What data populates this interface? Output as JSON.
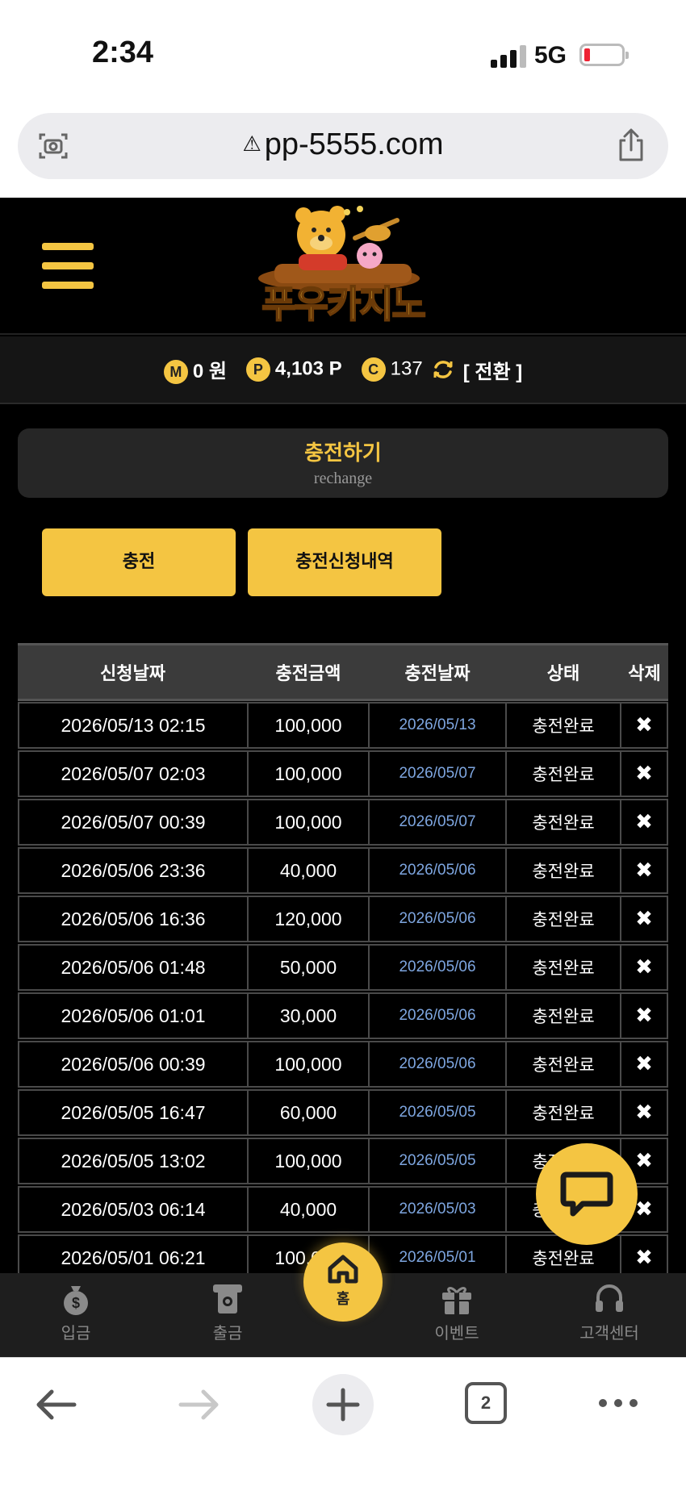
{
  "status_bar": {
    "time": "2:34",
    "network": "5G"
  },
  "browser": {
    "url": "pp-5555.com",
    "warning_glyph": "⚠",
    "tabs_count": "2"
  },
  "site": {
    "logo_text": "푸우카지노",
    "balance": {
      "m_badge": "M",
      "m_value": "0 원",
      "p_badge": "P",
      "p_value": "4,103 P",
      "c_badge": "C",
      "c_value": "137",
      "convert_label": "[ 전환 ]"
    },
    "section": {
      "title": "충전하기",
      "subtitle": "rechange"
    },
    "buttons": {
      "charge": "충전",
      "history": "충전신청내역"
    },
    "table": {
      "headers": [
        "신청날짜",
        "충전금액",
        "충전날짜",
        "상태",
        "삭제"
      ],
      "rows": [
        [
          "2026/05/13 02:15",
          "100,000",
          "2026/05/13",
          "충전완료"
        ],
        [
          "2026/05/07 02:03",
          "100,000",
          "2026/05/07",
          "충전완료"
        ],
        [
          "2026/05/07 00:39",
          "100,000",
          "2026/05/07",
          "충전완료"
        ],
        [
          "2026/05/06 23:36",
          "40,000",
          "2026/05/06",
          "충전완료"
        ],
        [
          "2026/05/06 16:36",
          "120,000",
          "2026/05/06",
          "충전완료"
        ],
        [
          "2026/05/06 01:48",
          "50,000",
          "2026/05/06",
          "충전완료"
        ],
        [
          "2026/05/06 01:01",
          "30,000",
          "2026/05/06",
          "충전완료"
        ],
        [
          "2026/05/06 00:39",
          "100,000",
          "2026/05/06",
          "충전완료"
        ],
        [
          "2026/05/05 16:47",
          "60,000",
          "2026/05/05",
          "충전완료"
        ],
        [
          "2026/05/05 13:02",
          "100,000",
          "2026/05/05",
          "충전완료"
        ],
        [
          "2026/05/03 06:14",
          "40,000",
          "2026/05/03",
          "충전완료"
        ],
        [
          "2026/05/01 06:21",
          "100,000",
          "2026/05/01",
          "충전완료"
        ]
      ],
      "delete_glyph": "✖"
    },
    "bottom_nav": {
      "deposit": "입금",
      "withdraw": "출금",
      "home": "홈",
      "event": "이벤트",
      "support": "고객센터"
    }
  },
  "colors": {
    "accent": "#f4c542",
    "background": "#000000",
    "date_link": "#7ea6e0"
  }
}
